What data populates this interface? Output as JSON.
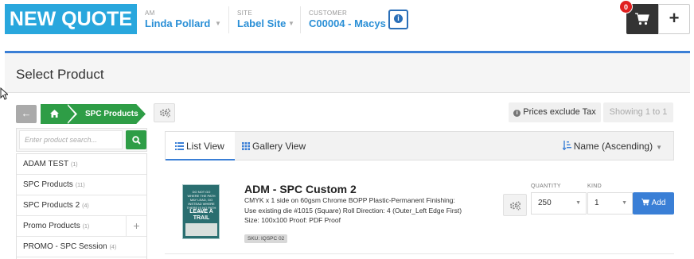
{
  "header": {
    "brand": "NEW QUOTE",
    "am": {
      "label": "AM",
      "value": "Linda Pollard"
    },
    "site": {
      "label": "SITE",
      "value": "Label Site"
    },
    "customer": {
      "label": "CUSTOMER",
      "value": "C00004 - Macys"
    },
    "cart_count": "0",
    "plus": "+"
  },
  "page_title": "Select Product",
  "breadcrumb": {
    "current": "SPC Products"
  },
  "prices_note": "Prices exclude Tax",
  "showing": "Showing 1 to 1",
  "search": {
    "placeholder": "Enter product search..."
  },
  "categories": [
    {
      "name": "ADAM TEST",
      "count": "(1)"
    },
    {
      "name": "SPC Products",
      "count": "(11)"
    },
    {
      "name": "SPC Products 2",
      "count": "(4)"
    },
    {
      "name": "Promo Products",
      "count": "(1)"
    },
    {
      "name": "PROMO - SPC Session",
      "count": "(4)"
    }
  ],
  "tabs": {
    "list": "List View",
    "gallery": "Gallery View"
  },
  "sort": "Name (Ascending)",
  "product": {
    "name": "ADM - SPC Custom 2",
    "description": "CMYK x 1 side on 60gsm Chrome BOPP Plastic-Permanent Finishing: Use existing die #1015 (Square) Roll Direction: 4 (Outer_Left Edge First) Size: 100x100 Proof: PDF Proof",
    "sku": "SKU: IQSPC 02",
    "quantity_label": "QUANTITY",
    "quantity": "250",
    "kind_label": "KIND",
    "kind": "1",
    "add_label": "Add",
    "thumb_text_top": "DO NOT GO WHERE THE PATH MAY LEAD, GO INSTEAD WHERE THERE IS NO PATH AND",
    "thumb_text_main": "LEAVE A TRAIL"
  },
  "colors": {
    "brand": "#29a7dd",
    "green": "#2e9d46",
    "accent": "#3a7fd6",
    "badge": "#e02020"
  }
}
